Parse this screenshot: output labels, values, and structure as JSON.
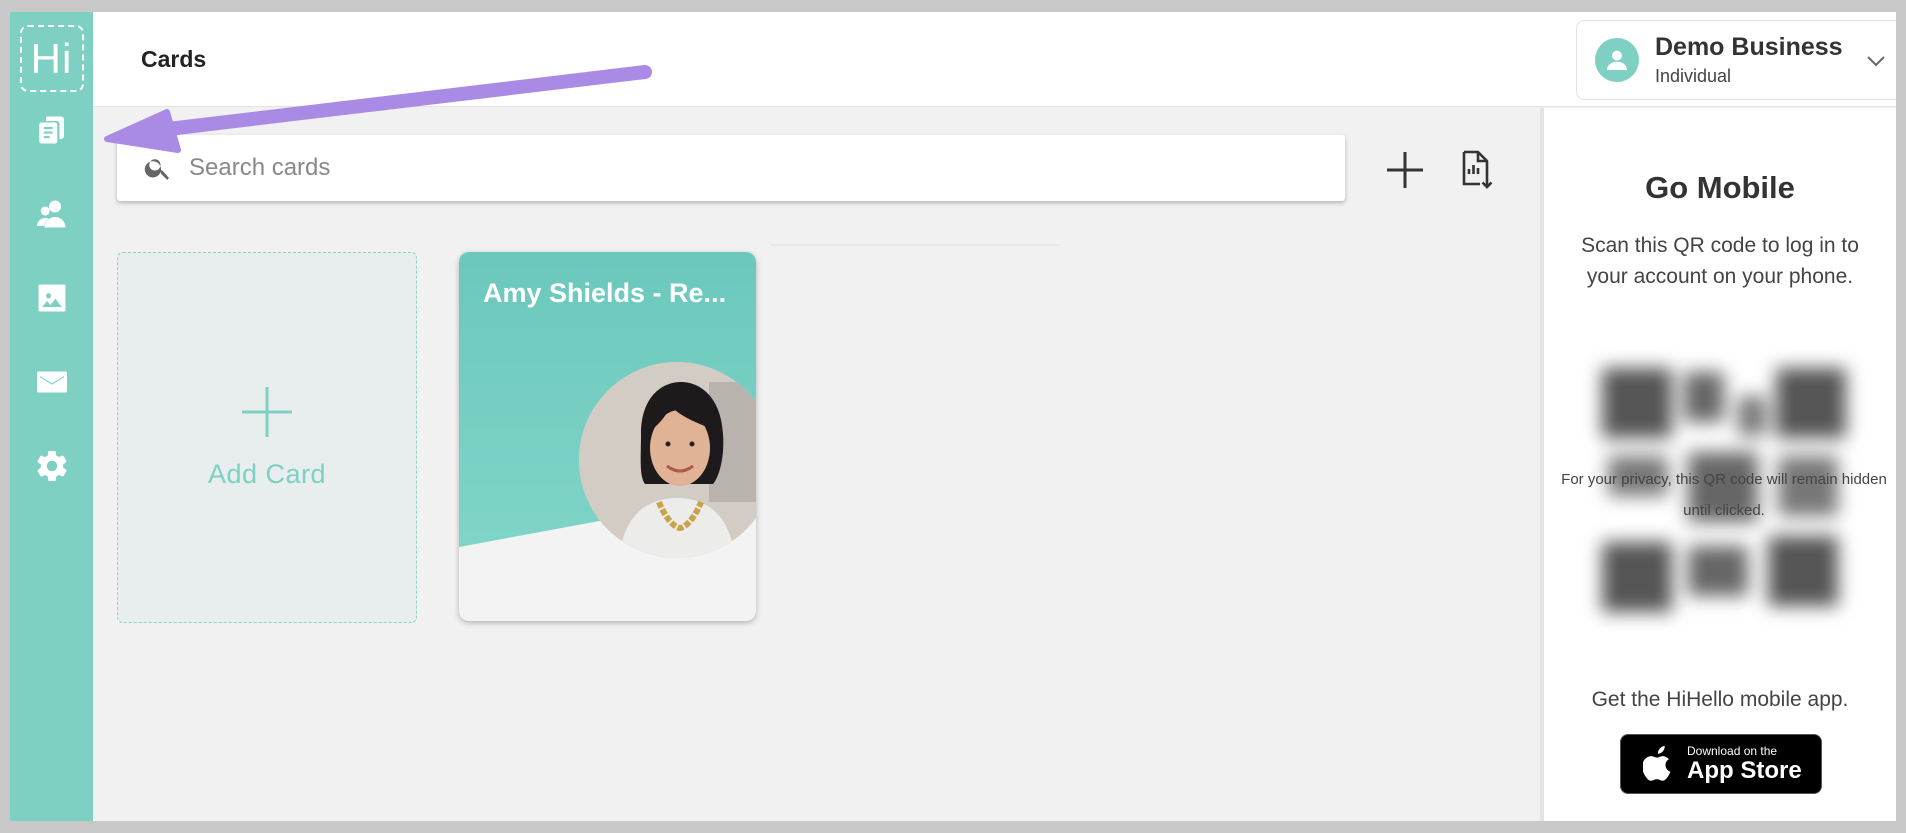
{
  "sidebar": {
    "logo_text": "Hi",
    "items": [
      {
        "name": "cards",
        "icon": "cards-icon"
      },
      {
        "name": "contacts",
        "icon": "contacts-icon"
      },
      {
        "name": "backgrounds",
        "icon": "image-icon"
      },
      {
        "name": "email-signatures",
        "icon": "mail-icon"
      },
      {
        "name": "settings",
        "icon": "gear-icon"
      }
    ],
    "color": "#7dd0c2"
  },
  "header": {
    "title": "Cards",
    "account": {
      "name": "Demo Business",
      "type": "Individual"
    }
  },
  "search": {
    "placeholder": "Search cards",
    "value": ""
  },
  "toolbar": {
    "add_icon": "plus-icon",
    "export_icon": "file-export-icon"
  },
  "cards": {
    "add_label": "Add Card",
    "items": [
      {
        "name": "Amy Shields - Re..."
      }
    ]
  },
  "mobile_panel": {
    "title": "Go Mobile",
    "description": "Scan this QR code to log in to your account on your phone.",
    "qr_note": "For your privacy, this QR code will remain hidden until clicked.",
    "get_app": "Get the HiHello mobile app.",
    "appstore_small": "Download on the",
    "appstore_big": "App Store"
  },
  "colors": {
    "accent": "#7dd0c2",
    "annotation_arrow": "#a98be6"
  }
}
